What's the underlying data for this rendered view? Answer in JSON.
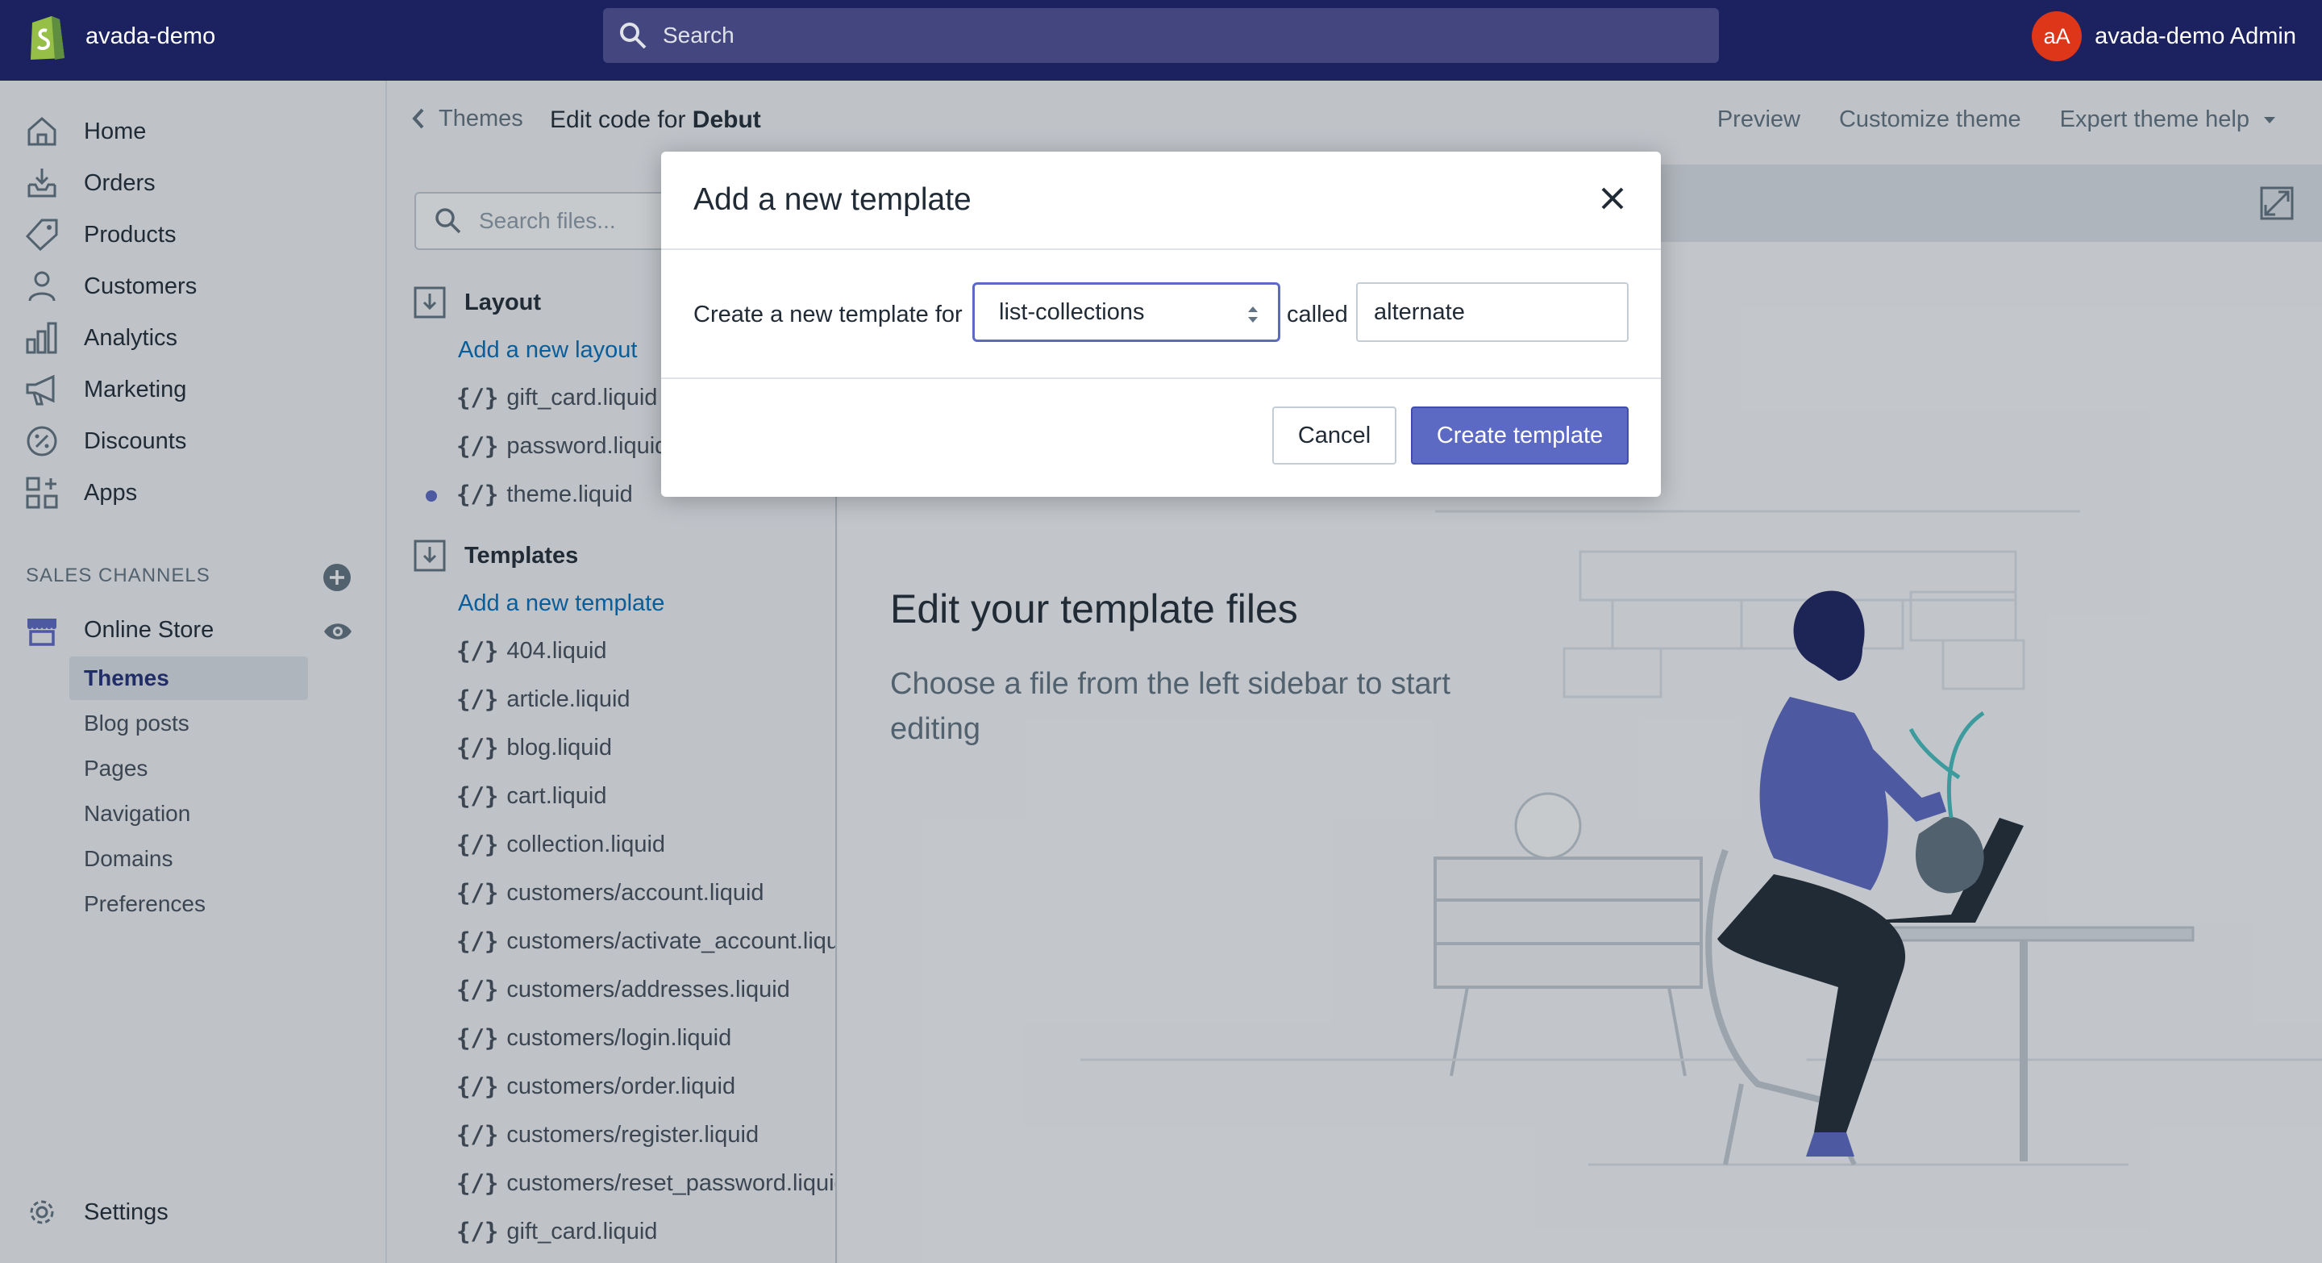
{
  "topbar": {
    "store_name": "avada-demo",
    "search_placeholder": "Search",
    "avatar_initials": "aA",
    "account_name": "avada-demo Admin"
  },
  "nav": {
    "items": [
      {
        "label": "Home",
        "icon": "home-icon"
      },
      {
        "label": "Orders",
        "icon": "orders-icon"
      },
      {
        "label": "Products",
        "icon": "tag-icon"
      },
      {
        "label": "Customers",
        "icon": "person-icon"
      },
      {
        "label": "Analytics",
        "icon": "bar-chart-icon"
      },
      {
        "label": "Marketing",
        "icon": "megaphone-icon"
      },
      {
        "label": "Discounts",
        "icon": "discount-icon"
      },
      {
        "label": "Apps",
        "icon": "apps-icon"
      }
    ],
    "sales_channels_heading": "SALES CHANNELS",
    "online_store": "Online Store",
    "sub_items": [
      "Themes",
      "Blog posts",
      "Pages",
      "Navigation",
      "Domains",
      "Preferences"
    ],
    "active_sub_item": "Themes",
    "settings": "Settings"
  },
  "header": {
    "breadcrumb": "Themes",
    "title_prefix": "Edit code for",
    "theme_name": "Debut",
    "actions": {
      "preview": "Preview",
      "customize": "Customize theme",
      "help": "Expert theme help"
    }
  },
  "files": {
    "search_placeholder": "Search files...",
    "layout_folder": "Layout",
    "add_layout": "Add a new layout",
    "layout_files": [
      "gift_card.liquid",
      "password.liquid",
      "theme.liquid"
    ],
    "templates_folder": "Templates",
    "add_template": "Add a new template",
    "template_files": [
      "404.liquid",
      "article.liquid",
      "blog.liquid",
      "cart.liquid",
      "collection.liquid",
      "customers/account.liquid",
      "customers/activate_account.liquid",
      "customers/addresses.liquid",
      "customers/login.liquid",
      "customers/order.liquid",
      "customers/register.liquid",
      "customers/reset_password.liquid",
      "gift_card.liquid"
    ],
    "liquid_glyph": "{/}"
  },
  "editor": {
    "empty_title": "Edit your template files",
    "empty_description": "Choose a file from the left sidebar to start editing"
  },
  "modal": {
    "title": "Add a new template",
    "label_for": "Create a new template for",
    "selected_type": "list-collections",
    "label_called": "called",
    "name_value": "alternate",
    "cancel": "Cancel",
    "create": "Create template"
  },
  "colors": {
    "topbar": "#1c2260",
    "primary": "#5c6ac4",
    "link": "#006fbb",
    "avatar": "#de3618"
  }
}
